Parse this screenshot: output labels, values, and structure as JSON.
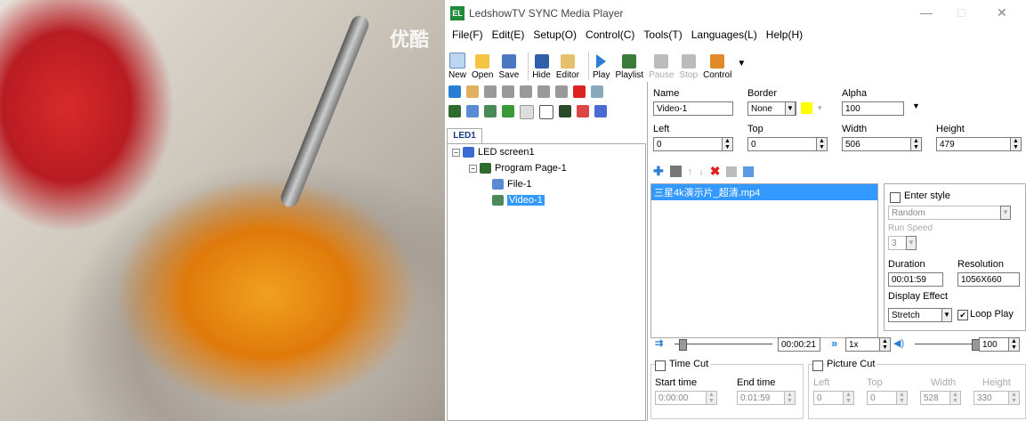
{
  "preview": {
    "watermark": "优酷"
  },
  "window": {
    "title": "LedshowTV SYNC Media Player",
    "app_icon": "EL",
    "min_glyph": "—",
    "max_glyph": "□",
    "close_glyph": "✕"
  },
  "menu": [
    "File(F)",
    "Edit(E)",
    "Setup(O)",
    "Control(C)",
    "Tools(T)",
    "Languages(L)",
    "Help(H)"
  ],
  "toolbar": {
    "new": "New",
    "open": "Open",
    "save": "Save",
    "hide": "Hide",
    "editor": "Editor",
    "play": "Play",
    "playlist": "Playlist",
    "pause": "Pause",
    "stop": "Stop",
    "control": "Control",
    "more": "▼"
  },
  "tab": {
    "label": "LED1"
  },
  "tree": {
    "screen": "LED screen1",
    "program": "Program Page-1",
    "file": "File-1",
    "video": "Video-1"
  },
  "props": {
    "name_label": "Name",
    "name_value": "Video-1",
    "border_label": "Border",
    "border_value": "None",
    "alpha_label": "Alpha",
    "alpha_value": "100",
    "left_label": "Left",
    "left_value": "0",
    "top_label": "Top",
    "top_value": "0",
    "width_label": "Width",
    "width_value": "506",
    "height_label": "Height",
    "height_value": "479",
    "border_color": "#ffff00"
  },
  "filelist": {
    "item": "三星4k演示片_超清.mp4"
  },
  "effect": {
    "enter_style_label": "Enter style",
    "enter_style_value": "Random",
    "run_speed_label": "Run Speed",
    "run_speed_value": "3",
    "duration_label": "Duration",
    "duration_value": "00:01:59",
    "resolution_label": "Resolution",
    "resolution_value": "1056X660",
    "display_effect_label": "Display Effect",
    "display_effect_value": "Stretch",
    "loop_play_label": "Loop Play"
  },
  "playback": {
    "time": "00:00:21",
    "speed": "1x",
    "volume": "100",
    "progress": 0.08,
    "volume_level": 1.0
  },
  "timecut": {
    "label": "Time Cut",
    "start_label": "Start time",
    "start_value": "0:00:00",
    "end_label": "End time",
    "end_value": "0:01:59"
  },
  "piccut": {
    "label": "Picture Cut",
    "left_label": "Left",
    "left_value": "0",
    "top_label": "Top",
    "top_value": "0",
    "width_label": "Width",
    "width_value": "528",
    "height_label": "Height",
    "height_value": "330"
  }
}
